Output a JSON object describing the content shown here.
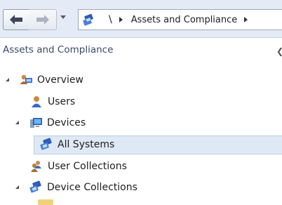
{
  "address_bar": {
    "back_icon": "arrow-left-icon",
    "forward_icon": "arrow-right-icon",
    "history_dropdown_icon": "chevron-down-icon",
    "root_separator": "\\",
    "path": [
      "Assets and Compliance"
    ]
  },
  "pane": {
    "title": "Assets and Compliance",
    "collapse_icon": "chevron-left-icon"
  },
  "tree": [
    {
      "label": "Overview",
      "icon": "overview-icon",
      "expanded": true
    },
    {
      "label": "Users",
      "icon": "user-icon"
    },
    {
      "label": "Devices",
      "icon": "devices-icon",
      "expanded": true
    },
    {
      "label": "All Systems",
      "icon": "collection-icon",
      "selected": true
    },
    {
      "label": "User Collections",
      "icon": "user-collection-icon"
    },
    {
      "label": "Device Collections",
      "icon": "collection-icon",
      "expanded": true
    }
  ],
  "colors": {
    "address_bar_bg": "#e4ebf6",
    "selection_bg": "#dfe9f5",
    "pane_title": "#3a4a62"
  }
}
